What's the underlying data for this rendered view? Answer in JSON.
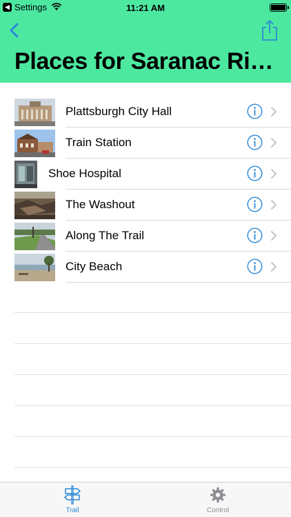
{
  "status_bar": {
    "back_app": "Settings",
    "time": "11:21 AM",
    "icons": [
      "wifi-icon",
      "battery-icon"
    ]
  },
  "nav": {
    "back_icon": "chevron-left-icon",
    "share_icon": "share-icon",
    "title": "Places for Saranac Riv..."
  },
  "places": [
    {
      "name": "Plattsburgh City Hall",
      "thumb": "city-hall-photo"
    },
    {
      "name": "Train Station",
      "thumb": "train-station-photo"
    },
    {
      "name": "Shoe Hospital",
      "thumb": "shoe-hospital-photo"
    },
    {
      "name": "The Washout",
      "thumb": "washout-photo"
    },
    {
      "name": "Along The Trail",
      "thumb": "trail-photo"
    },
    {
      "name": "City Beach",
      "thumb": "beach-photo"
    }
  ],
  "row_icons": {
    "info": "info-circle-icon",
    "chevron": "chevron-right-icon"
  },
  "tabbar": {
    "tabs": [
      {
        "label": "Trail",
        "icon": "signpost-icon",
        "selected": true
      },
      {
        "label": "Control",
        "icon": "gear-icon",
        "selected": false
      }
    ]
  },
  "colors": {
    "header_bg": "#4de8a0",
    "accent": "#2b88d8",
    "tab_inactive": "#8e8e93"
  }
}
